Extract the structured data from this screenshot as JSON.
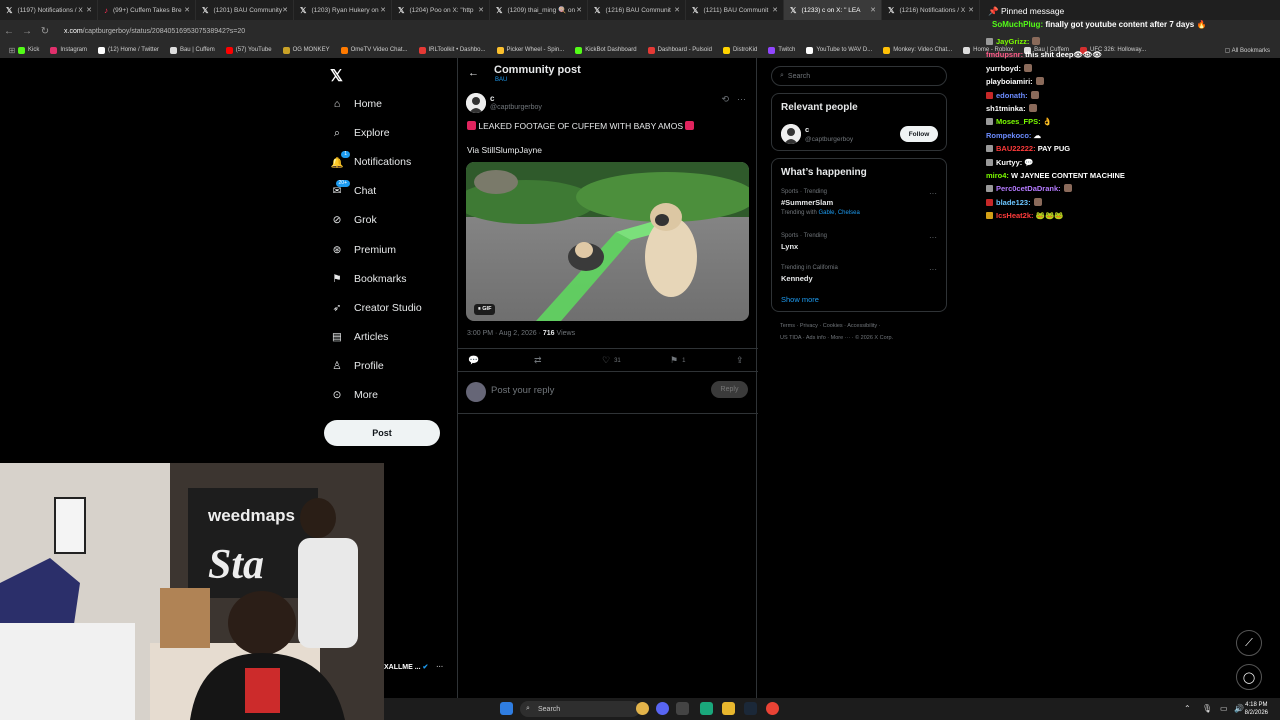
{
  "browser": {
    "tabs": [
      {
        "label": "(1197) Notifications / X",
        "icon": "x-logo",
        "active": false
      },
      {
        "label": "(99+) Cuffem Takes Bre",
        "icon": "tiktok-logo",
        "active": false
      },
      {
        "label": "(1201) BAU Community",
        "icon": "x-logo",
        "active": false
      },
      {
        "label": "(1203) Ryan Hukery on",
        "icon": "x-logo",
        "active": false
      },
      {
        "label": "(1204) Poo on X: \"http",
        "icon": "x-logo",
        "active": false
      },
      {
        "label": "(1209) thai_ming 🍭 on",
        "icon": "x-logo",
        "active": false
      },
      {
        "label": "(1216) BAU Communit",
        "icon": "x-logo",
        "active": false
      },
      {
        "label": "(1211) BAU Communit",
        "icon": "x-logo",
        "active": false
      },
      {
        "label": "(1233) c on X: \" LEA",
        "icon": "x-logo",
        "active": true
      },
      {
        "label": "(1216) Notifications / X",
        "icon": "x-logo",
        "active": false
      }
    ],
    "url_host": "x.com",
    "url_path": "/captburgerboy/status/2084051695307538942?s=20",
    "bookmarks": [
      {
        "label": "Kick",
        "color": "#53fc18"
      },
      {
        "label": "Instagram",
        "color": "#e1306c"
      },
      {
        "label": "(12) Home / Twitter",
        "color": "#ffffff"
      },
      {
        "label": "Bau | Cuffem",
        "color": "#dddddd"
      },
      {
        "label": "(57) YouTube",
        "color": "#ff0000"
      },
      {
        "label": "OG MONKEY",
        "color": "#c9a227"
      },
      {
        "label": "OmeTV Video Chat...",
        "color": "#ff7a00"
      },
      {
        "label": "IRLToolkit • Dashbo...",
        "color": "#e53935"
      },
      {
        "label": "Picker Wheel - Spin...",
        "color": "#fbc02d"
      },
      {
        "label": "KickBot Dashboard",
        "color": "#53fc18"
      },
      {
        "label": "Dashboard - Pulsoid",
        "color": "#e53935"
      },
      {
        "label": "DistroKid",
        "color": "#ffd400"
      },
      {
        "label": "Twitch",
        "color": "#9146ff"
      },
      {
        "label": "YouTube to WAV D...",
        "color": "#ffffff"
      },
      {
        "label": "Monkey: Video Chat...",
        "color": "#ffc107"
      },
      {
        "label": "Home - Roblox",
        "color": "#dddddd"
      },
      {
        "label": "Bau | Cuffem",
        "color": "#dddddd"
      },
      {
        "label": "UFC 326: Holloway...",
        "color": "#d32f2f"
      }
    ],
    "all_bookmarks": "All Bookmarks"
  },
  "nav": {
    "items": [
      {
        "label": "Home",
        "icon": "home-icon"
      },
      {
        "label": "Explore",
        "icon": "search-icon"
      },
      {
        "label": "Notifications",
        "icon": "bell-icon",
        "badge": "1"
      },
      {
        "label": "Chat",
        "icon": "chat-icon",
        "badge": "20+"
      },
      {
        "label": "Grok",
        "icon": "grok-icon"
      },
      {
        "label": "Premium",
        "icon": "premium-icon"
      },
      {
        "label": "Bookmarks",
        "icon": "bookmark-icon"
      },
      {
        "label": "Creator Studio",
        "icon": "rocket-icon"
      },
      {
        "label": "Articles",
        "icon": "article-icon"
      },
      {
        "label": "Profile",
        "icon": "person-icon"
      },
      {
        "label": "More",
        "icon": "more-icon"
      }
    ],
    "post_button": "Post"
  },
  "post": {
    "header_title": "Community post",
    "header_sub": "BAU",
    "author_name": "c",
    "author_handle": "@captburgerboy",
    "text_line1": "LEAKED FOOTAGE OF CUFFEM WITH BABY AMOS",
    "text_line2": "Via StillSlumpJayne",
    "gif_label": "GIF",
    "timestamp": "3:00 PM · Aug 2, 2026 · ",
    "views_count": "716",
    "views_label": " Views",
    "likes": "31",
    "bookmarks": "1",
    "reply_placeholder": "Post your reply",
    "reply_button": "Reply"
  },
  "sidebar": {
    "search_placeholder": "Search",
    "relevant_title": "Relevant people",
    "relevant_name": "c",
    "relevant_handle": "@captburgerboy",
    "follow_label": "Follow",
    "happening_title": "What’s happening",
    "trends": [
      {
        "meta": "Sports · Trending",
        "name": "#SummerSlam",
        "with_prefix": "Trending with ",
        "with_links": "Gable, Chelsea"
      },
      {
        "meta": "Sports · Trending",
        "name": "Lynx"
      },
      {
        "meta": "Trending in California",
        "name": "Kennedy"
      }
    ],
    "show_more": "Show more",
    "footer_line1": "Terms · Privacy · Cookies · Accessibility ·",
    "footer_line2": "US TIDA · Ads info · More ··· · © 2026 X Corp."
  },
  "chat": {
    "pinned_label": "Pinned message",
    "pinned_user": "SoMuchPlug:",
    "pinned_text": " finally got youtube content after 7 days 🔥",
    "lines": [
      {
        "user": "JayGrizz:",
        "text": "",
        "color": "#7CFC00",
        "badge": "#999999",
        "emote": true
      },
      {
        "user": "fmdupsnr:",
        "text": " this shit deep👁👁👁",
        "color": "#ff5c8a",
        "badge": "",
        "emote": false
      },
      {
        "user": "yurrboyd:",
        "text": "",
        "color": "#ffffff",
        "badge": "",
        "emote": true
      },
      {
        "user": "playboiamiri:",
        "text": "",
        "color": "#ffffff",
        "badge": "",
        "emote": true
      },
      {
        "user": "edonath:",
        "text": "",
        "color": "#6c8cff",
        "badge": "#c62828",
        "emote": true
      },
      {
        "user": "sh1tminka:",
        "text": "",
        "color": "#ffffff",
        "badge": "",
        "emote": true
      },
      {
        "user": "Moses_FPS:",
        "text": " 👌",
        "color": "#7CFC00",
        "badge": "#999999",
        "emote": false
      },
      {
        "user": "Rompekoco:",
        "text": " ☁",
        "color": "#6c8cff",
        "badge": "",
        "emote": false
      },
      {
        "user": "BAU22222:",
        "text": " PAY PUG",
        "color": "#ff3b3b",
        "badge": "#999999",
        "emote": false
      },
      {
        "user": "Kurtyy:",
        "text": " 💬",
        "color": "#ffffff",
        "badge": "#999999",
        "emote": false
      },
      {
        "user": "miro4:",
        "text": " W JAYNEE CONTENT MACHINE",
        "color": "#7CFC00",
        "badge": "",
        "emote": false
      },
      {
        "user": "Perc0cetDaDrank:",
        "text": "",
        "color": "#b57bff",
        "badge": "#999999",
        "emote": true
      },
      {
        "user": "blade123:",
        "text": "",
        "color": "#6cc6ff",
        "badge": "#c62828",
        "emote": true
      },
      {
        "user": "IcsHeat2k:",
        "text": " 🐸🐸🐸",
        "color": "#ff3b3b",
        "badge": "#d4a017",
        "emote": false
      }
    ]
  },
  "webcam": {
    "banner_text": "weedmaps",
    "overlay_name": "XALLME ..."
  },
  "taskbar": {
    "search_label": "Search",
    "time": "4:18 PM",
    "date": "8/2/2026"
  }
}
